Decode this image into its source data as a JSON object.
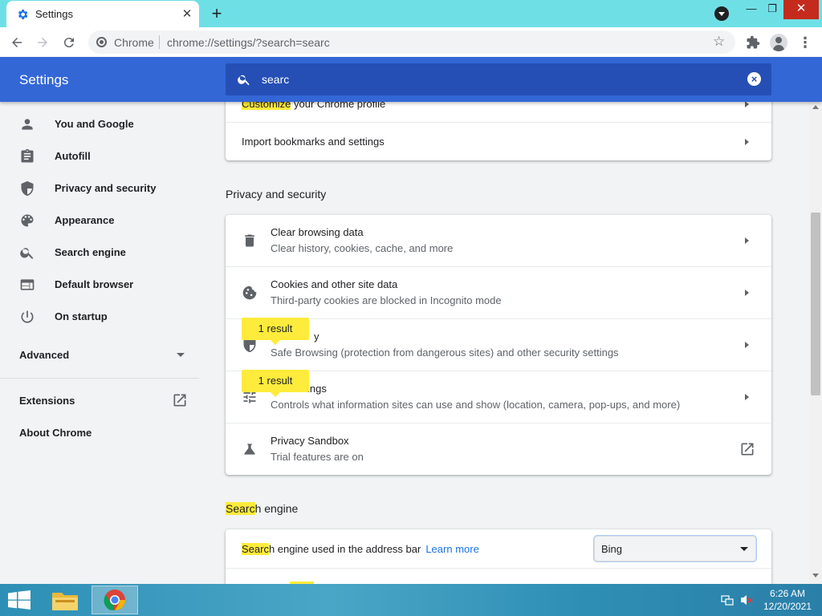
{
  "browser": {
    "tab_title": "Settings",
    "tab_close": "✕",
    "new_tab": "+",
    "omnibox_chrome_label": "Chrome",
    "url": "chrome://settings/?search=searc",
    "window_min": "—",
    "window_max": "❐",
    "window_close": "✕"
  },
  "header": {
    "title": "Settings",
    "search_value": "searc",
    "search_clear": "×"
  },
  "sidebar": {
    "items": [
      {
        "label": "You and Google",
        "icon": "person-icon"
      },
      {
        "label": "Autofill",
        "icon": "clipboard-icon"
      },
      {
        "label": "Privacy and security",
        "icon": "shield-icon"
      },
      {
        "label": "Appearance",
        "icon": "palette-icon"
      },
      {
        "label": "Search engine",
        "icon": "search-icon"
      },
      {
        "label": "Default browser",
        "icon": "browser-window-icon"
      },
      {
        "label": "On startup",
        "icon": "power-icon"
      }
    ],
    "advanced": "Advanced",
    "extensions": "Extensions",
    "about": "About Chrome"
  },
  "main": {
    "top_card": {
      "partial_row_hl": "Customize",
      "partial_row_rest": " your Chrome profile",
      "import_row": "Import bookmarks and settings"
    },
    "privacy_section_title": "Privacy and security",
    "privacy_rows": [
      {
        "title": "Clear browsing data",
        "subtitle": "Clear history, cookies, cache, and more",
        "icon": "trash-icon"
      },
      {
        "title": "Cookies and other site data",
        "subtitle": "Third-party cookies are blocked in Incognito mode",
        "icon": "cookie-icon"
      },
      {
        "title": "Security",
        "title_visible": "y",
        "subtitle": "Safe Browsing (protection from dangerous sites) and other security settings",
        "icon": "shield-icon"
      },
      {
        "title": "Site Settings",
        "title_visible": "ings",
        "subtitle": "Controls what information sites can use and show (location, camera, pop-ups, and more)",
        "icon": "sliders-icon"
      },
      {
        "title": "Privacy Sandbox",
        "subtitle": "Trial features are on",
        "icon": "flask-icon"
      }
    ],
    "result_bubble_1": "1 result",
    "result_bubble_2": "1 result",
    "search_section_title_hl": "Searc",
    "search_section_title_rest": "h engine",
    "search_engine_row_hl": "Searc",
    "search_engine_row_rest": "h engine used in the address bar",
    "learn_more": "Learn more",
    "engine_selected": "Bing"
  },
  "taskbar": {
    "time": "6:26 AM",
    "date": "12/20/2021"
  },
  "colors": {
    "header_blue": "#3367d6",
    "search_blue": "#254fb5",
    "highlight_yellow": "#ffeb3b",
    "link_blue": "#1a73e8",
    "tabbar_cyan": "#6fdfe6"
  }
}
